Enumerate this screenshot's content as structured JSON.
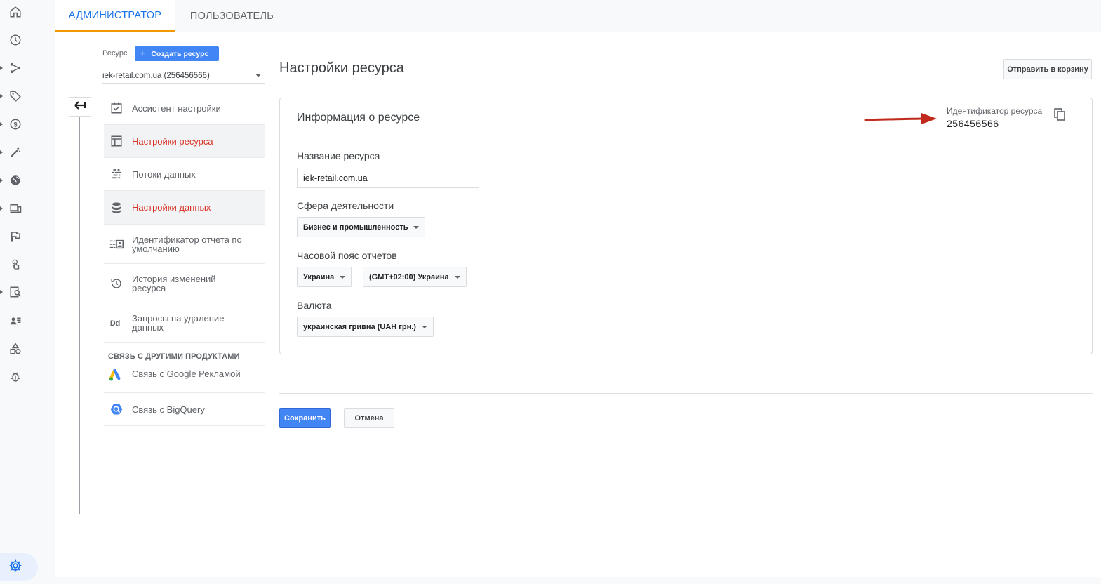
{
  "rail": {
    "items": [
      {
        "icon": "home-icon",
        "caret": false
      },
      {
        "icon": "clock-icon",
        "caret": false
      },
      {
        "icon": "flow-icon",
        "caret": true
      },
      {
        "icon": "tag-icon",
        "caret": true
      },
      {
        "icon": "dollar-icon",
        "caret": true
      },
      {
        "icon": "magic-icon",
        "caret": true
      },
      {
        "icon": "globe-icon",
        "caret": true
      },
      {
        "icon": "devices-icon",
        "caret": true
      },
      {
        "icon": "flag-icon",
        "caret": false
      },
      {
        "icon": "touch-icon",
        "caret": false
      },
      {
        "icon": "analytics-icon",
        "caret": true
      },
      {
        "icon": "user-list-icon",
        "caret": false
      },
      {
        "icon": "shapes-icon",
        "caret": false
      },
      {
        "icon": "bug-icon",
        "caret": false
      }
    ],
    "settings_icon": "gear-icon"
  },
  "tabs": {
    "admin": "АДМИНИСТРАТОР",
    "user": "ПОЛЬЗОВАТЕЛЬ"
  },
  "resource": {
    "label": "Ресурс",
    "create_button": "Создать ресурс",
    "selected": "iek-retail.com.ua (256456566)"
  },
  "nav": {
    "items": [
      {
        "label": "Ассистент настройки",
        "icon": "checkbox-icon",
        "active": false
      },
      {
        "label": "Настройки ресурса",
        "icon": "layout-icon",
        "active": true
      },
      {
        "label": "Потоки данных",
        "icon": "streams-icon",
        "active": false
      },
      {
        "label": "Настройки данных",
        "icon": "database-icon",
        "active": true
      },
      {
        "label": "Идентификатор отчета по умолчанию",
        "icon": "report-id-icon",
        "active": false
      },
      {
        "label": "История изменений ресурса",
        "icon": "history-icon",
        "active": false
      },
      {
        "label": "Запросы на удаление данных",
        "icon": "dd-icon",
        "active": false
      }
    ],
    "section_title": "СВЯЗЬ С ДРУГИМИ ПРОДУКТАМИ",
    "links": [
      {
        "label": "Связь с Google Рекламой",
        "icon": "google-ads-icon"
      },
      {
        "label": "Связь с BigQuery",
        "icon": "bigquery-icon"
      }
    ]
  },
  "page": {
    "title": "Настройки ресурса",
    "trash_button": "Отправить в корзину"
  },
  "card": {
    "title": "Информация о ресурсе",
    "id_label": "Идентификатор ресурса",
    "id_value": "256456566",
    "fields": {
      "name_label": "Название ресурса",
      "name_value": "iek-retail.com.ua",
      "industry_label": "Сфера деятельности",
      "industry_value": "Бизнес и промышленность",
      "timezone_label": "Часовой пояс отчетов",
      "country_value": "Украина",
      "timezone_value": "(GMT+02:00) Украина",
      "currency_label": "Валюта",
      "currency_value": "украинская гривна (UAH грн.)"
    }
  },
  "actions": {
    "save": "Сохранить",
    "cancel": "Отмена"
  },
  "colors": {
    "accent": "#1a73e8",
    "active_nav": "#d93025",
    "tab_underline": "#f29900",
    "arrow": "#c0291b"
  }
}
